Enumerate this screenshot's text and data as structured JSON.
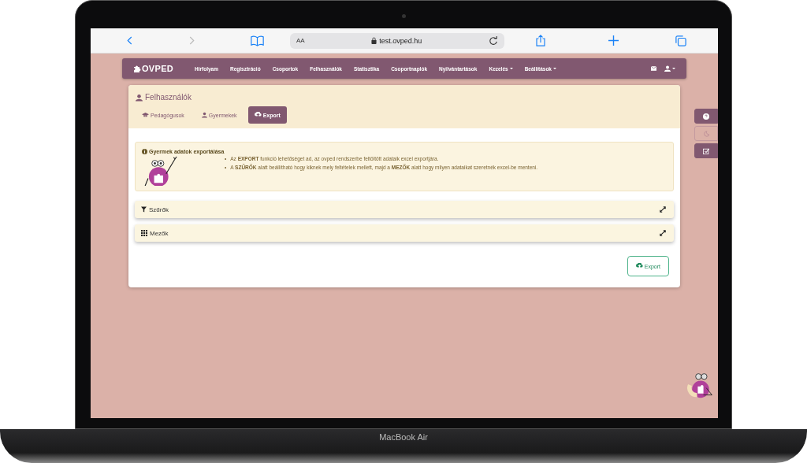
{
  "browser": {
    "text_size": "AA",
    "url": "test.ovped.hu"
  },
  "navbar": {
    "brand": "OVPED",
    "items": [
      {
        "label": "Hírfolyam",
        "dropdown": false
      },
      {
        "label": "Regisztráció",
        "dropdown": false
      },
      {
        "label": "Csoportok",
        "dropdown": false
      },
      {
        "label": "Felhasználók",
        "dropdown": false
      },
      {
        "label": "Statisztika",
        "dropdown": false
      },
      {
        "label": "Csoportnaplók",
        "dropdown": false
      },
      {
        "label": "Nyilvántartások",
        "dropdown": false
      },
      {
        "label": "Kezelés",
        "dropdown": true
      },
      {
        "label": "Beállítások",
        "dropdown": true
      }
    ]
  },
  "page": {
    "title": "Felhasználók",
    "tabs": [
      {
        "label": "Pedagógusok",
        "kind": "cap",
        "selected": false
      },
      {
        "label": "Gyermekek",
        "kind": "user",
        "selected": false
      },
      {
        "label": "Export",
        "kind": "cloud",
        "selected": true
      }
    ],
    "info": {
      "title": "Gyermek adatok exportálása",
      "bullets": [
        {
          "marker": "•",
          "text": "Az **EXPORT** funkció lehetőséget ad, az ovped rendszerbe feltöltött adataik excel exportjára."
        },
        {
          "marker": "•",
          "text": "A **SZŰRŐK** alatt beállítható hogy kiknek mely feltételek mellett, majd a **MEZŐK** alatt hogy milyen adataikat szeretnék excel-be menteni."
        }
      ]
    },
    "panels": [
      {
        "label": "Szűrők",
        "kind": "filter"
      },
      {
        "label": "Mezők",
        "kind": "grid"
      }
    ],
    "export_button": "Export"
  },
  "side_buttons": [
    {
      "kind": "help",
      "outlined": false
    },
    {
      "kind": "moon",
      "outlined": true
    },
    {
      "kind": "check",
      "outlined": false
    }
  ],
  "laptop_label": "MacBook Air"
}
